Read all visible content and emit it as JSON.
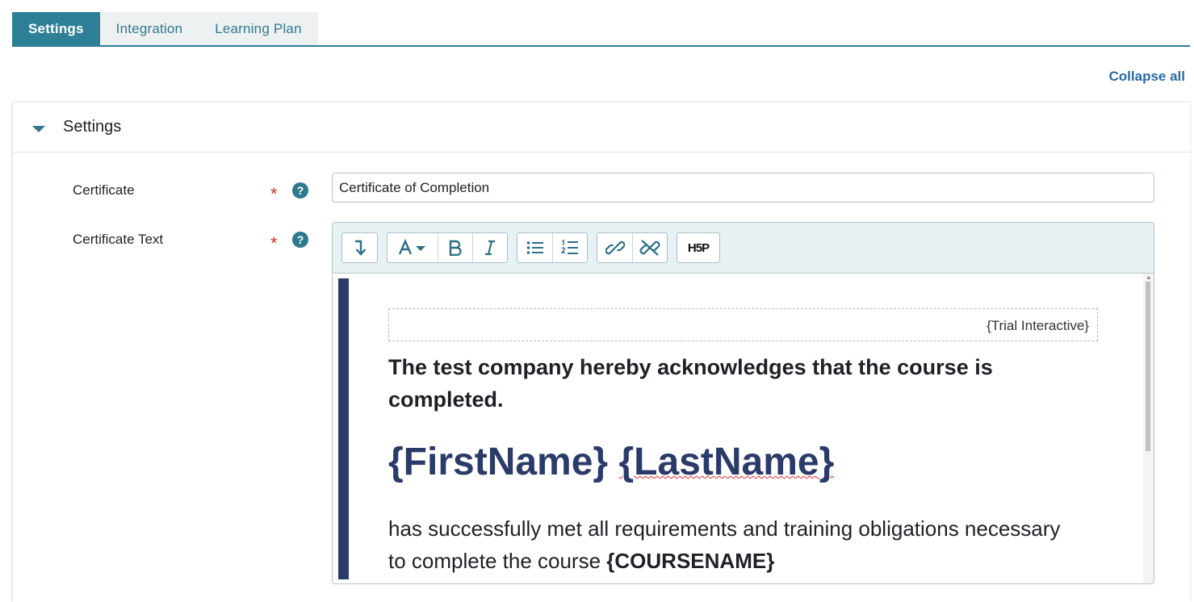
{
  "tabs": [
    {
      "label": "Settings",
      "active": true
    },
    {
      "label": "Integration",
      "active": false
    },
    {
      "label": "Learning Plan",
      "active": false
    }
  ],
  "collapse_all": "Collapse all",
  "section": {
    "title": "Settings"
  },
  "fields": {
    "certificate": {
      "label": "Certificate",
      "required_mark": "*",
      "help_icon": "?",
      "value": "Certificate of Completion"
    },
    "certificate_text": {
      "label": "Certificate Text",
      "required_mark": "*",
      "help_icon": "?"
    }
  },
  "toolbar": {
    "groups": [
      [
        "collapse-toggle-icon"
      ],
      [
        "font-color-icon",
        "bold-icon",
        "italic-icon"
      ],
      [
        "bullet-list-icon",
        "numbered-list-icon"
      ],
      [
        "link-icon",
        "unlink-icon"
      ],
      [
        "h5p-icon"
      ]
    ],
    "h5p_label": "H5P"
  },
  "editor_content": {
    "trial_placeholder": "{Trial Interactive}",
    "heading": "The test company hereby acknowledges that the course is completed.",
    "first_name": "{FirstName}",
    "last_name": "{LastName}",
    "body_text": "has successfully met all requirements and training obligations necessary to complete the course",
    "course_name": "{COURSENAME}"
  },
  "colors": {
    "accent": "#2e8096",
    "link": "#2a6ba1",
    "name_color": "#2b3b69",
    "required": "#c0392b"
  }
}
